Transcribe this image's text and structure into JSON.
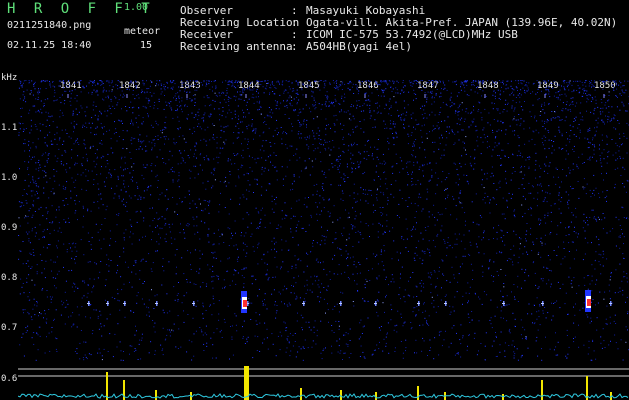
{
  "header": {
    "app_name": "H R O F F T",
    "version": "1.00",
    "filename": "0211251840.png",
    "datetime": "02.11.25 18:40",
    "meteor_label": "meteor",
    "meteor_count": "15",
    "info": [
      {
        "label": "Observer",
        "value": "Masayuki Kobayashi"
      },
      {
        "label": "Receiving Location",
        "value": "Ogata-vill. Akita-Pref. JAPAN (139.96E, 40.02N)"
      },
      {
        "label": "Receiver",
        "value": "ICOM IC-575 53.7492(@LCD)MHz USB"
      },
      {
        "label": "Receiving antenna",
        "value": "A504HB(yagi 4el)"
      }
    ],
    "colon": ":"
  },
  "axes": {
    "y_unit": "kHz",
    "y_ticks": [
      "1.1",
      "1.0",
      "0.9",
      "0.8",
      "0.7",
      "0.6"
    ],
    "x_ticks": [
      "1841",
      "1842",
      "1843",
      "1844",
      "1845",
      "1846",
      "1847",
      "1848",
      "1849",
      "1850"
    ]
  },
  "colors": {
    "background": "#000000",
    "noise": "#1a2bd8",
    "signal_core": "#ff3030",
    "signal_edge": "#ffffff",
    "meteor_bar": "#f2e600",
    "baseline": "#2fc9e0",
    "guide_line": "#d0d0d0",
    "header_green": "#5fe07a",
    "header_white": "#e8e8e8"
  }
}
